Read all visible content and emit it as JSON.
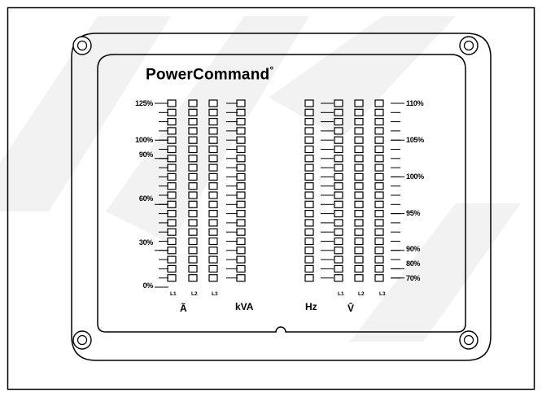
{
  "panel": {
    "brand": "PowerCommand",
    "brand_mark": "°"
  },
  "left_scale": {
    "ticks": [
      "125%",
      "100%",
      "90%",
      "60%",
      "30%",
      "0%"
    ]
  },
  "right_scale": {
    "ticks": [
      "110%",
      "105%",
      "100%",
      "95%",
      "90%",
      "80%",
      "70%"
    ]
  },
  "meters": {
    "current_phases": [
      "L1",
      "L2",
      "L3"
    ],
    "voltage_phases": [
      "L1",
      "L2",
      "L3"
    ],
    "leds_per_column": 20
  },
  "labels": {
    "current": "Ã",
    "kva": "kVA",
    "hz": "Hz",
    "voltage": "V̂"
  },
  "colors": {
    "line": "#000000",
    "background": "#ffffff",
    "watermark": "#f3f3f3"
  }
}
